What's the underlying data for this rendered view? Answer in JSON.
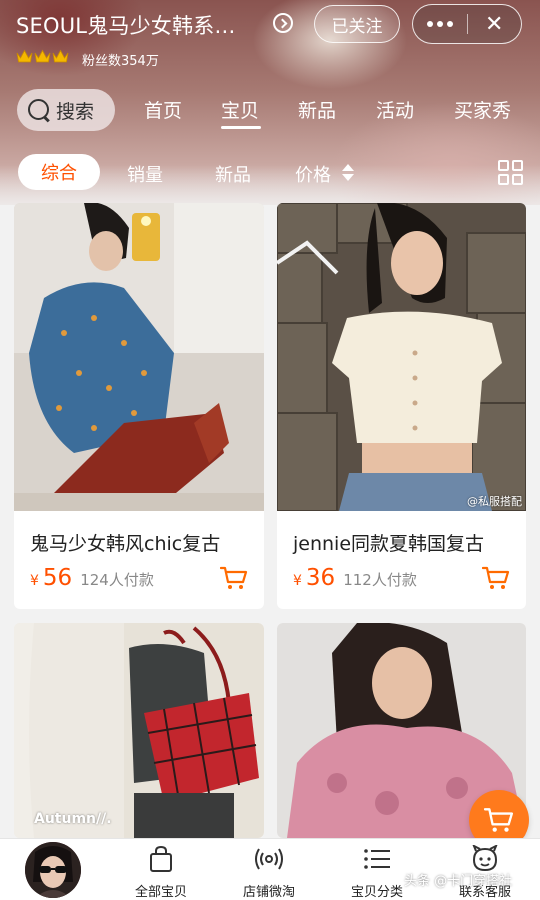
{
  "header": {
    "shop_name": "SEOUL鬼马少女韩系…",
    "follow_label": "已关注",
    "more_label": "•••",
    "close_label": "✕",
    "fans_text": "粉丝数354万",
    "crown_icons": [
      "crown-icon",
      "crown-icon",
      "crown-icon"
    ]
  },
  "nav": {
    "search_label": "搜索",
    "tabs": [
      {
        "label": "首页",
        "active": false
      },
      {
        "label": "宝贝",
        "active": true
      },
      {
        "label": "新品",
        "active": false
      },
      {
        "label": "活动",
        "active": false
      },
      {
        "label": "买家秀",
        "active": false
      }
    ]
  },
  "sort": {
    "items": [
      {
        "label": "综合",
        "active": true
      },
      {
        "label": "销量",
        "active": false
      },
      {
        "label": "新品",
        "active": false
      },
      {
        "label": "价格",
        "active": false
      }
    ],
    "view_icon": "grid-view-icon"
  },
  "products": [
    {
      "title": "鬼马少女韩风chic复古",
      "currency": "¥",
      "price": "56",
      "sold": "124人付款"
    },
    {
      "title": "jennie同款夏韩国复古",
      "currency": "¥",
      "price": "36",
      "sold": "112人付款",
      "photo_watermark": "@私服搭配"
    },
    {
      "photo_caption": "Autumn//."
    },
    {}
  ],
  "bottom_bar": {
    "items": [
      {
        "label": "全部宝贝",
        "icon": "shopping-bag-icon"
      },
      {
        "label": "店铺微淘",
        "icon": "broadcast-icon"
      },
      {
        "label": "宝贝分类",
        "icon": "list-icon"
      },
      {
        "label": "联系客服",
        "icon": "service-face-icon"
      }
    ]
  },
  "watermark": "头条 @卡门穿搭社",
  "colors": {
    "accent": "#ff5000",
    "fab": "#ff7a1c",
    "card_bg": "#ffffff",
    "page_bg": "#f2f2f2"
  }
}
